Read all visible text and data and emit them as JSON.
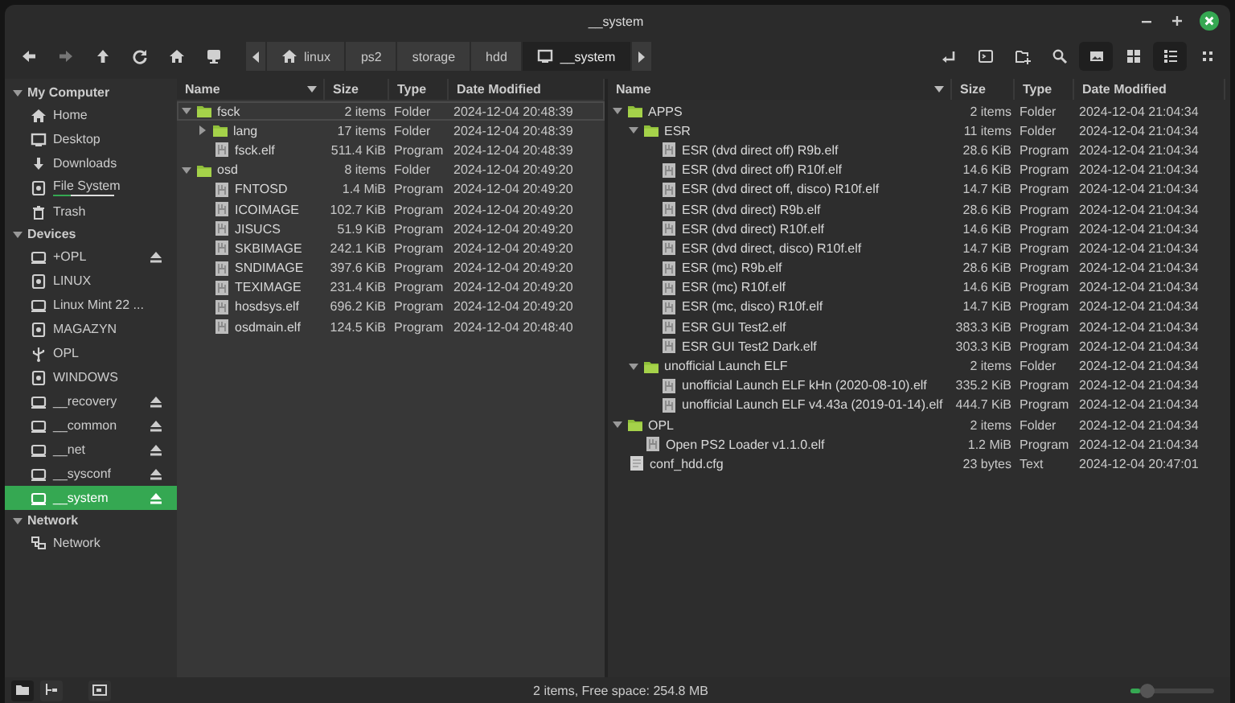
{
  "window": {
    "title": "__system"
  },
  "toolbar": {
    "nav": [
      {
        "kind": "back",
        "disabled": false
      },
      {
        "kind": "forward",
        "disabled": true
      },
      {
        "kind": "up",
        "disabled": false
      },
      {
        "kind": "reload",
        "disabled": false
      },
      {
        "kind": "home",
        "disabled": false
      },
      {
        "kind": "computer",
        "disabled": false
      }
    ],
    "breadcrumb": [
      {
        "label": "linux",
        "kind": "home",
        "selected": false
      },
      {
        "label": "ps2",
        "kind": "plain",
        "selected": false
      },
      {
        "label": "storage",
        "kind": "plain",
        "selected": false
      },
      {
        "label": "hdd",
        "kind": "plain",
        "selected": false
      },
      {
        "label": "__system",
        "kind": "drive",
        "selected": true
      }
    ],
    "actions": [
      {
        "kind": "return"
      },
      {
        "kind": "terminal"
      },
      {
        "kind": "new-folder"
      },
      {
        "kind": "search"
      }
    ],
    "views": [
      {
        "kind": "thumbnails",
        "pressed": true
      },
      {
        "kind": "icons",
        "pressed": false
      },
      {
        "kind": "list",
        "pressed": true
      },
      {
        "kind": "compact",
        "pressed": false
      }
    ]
  },
  "sidebar": [
    {
      "title": "My Computer",
      "expanded": true,
      "items": [
        {
          "label": "Home",
          "kind": "home",
          "eject": false,
          "selected": false
        },
        {
          "label": "Desktop",
          "kind": "desktop",
          "eject": false,
          "selected": false
        },
        {
          "label": "Downloads",
          "kind": "download",
          "eject": false,
          "selected": false
        },
        {
          "label": "File System",
          "kind": "disk",
          "eject": false,
          "selected": false,
          "level": 0.3
        },
        {
          "label": "Trash",
          "kind": "trash",
          "eject": false,
          "selected": false
        }
      ]
    },
    {
      "title": "Devices",
      "expanded": true,
      "items": [
        {
          "label": "+OPL",
          "kind": "drive",
          "eject": true,
          "selected": false
        },
        {
          "label": "LINUX",
          "kind": "disk",
          "eject": false,
          "selected": false
        },
        {
          "label": "Linux Mint 22 ...",
          "kind": "drive",
          "eject": false,
          "selected": false
        },
        {
          "label": "MAGAZYN",
          "kind": "disk",
          "eject": false,
          "selected": false
        },
        {
          "label": "OPL",
          "kind": "usb",
          "eject": false,
          "selected": false
        },
        {
          "label": "WINDOWS",
          "kind": "disk",
          "eject": false,
          "selected": false
        },
        {
          "label": "__recovery",
          "kind": "drive",
          "eject": true,
          "selected": false
        },
        {
          "label": "__common",
          "kind": "drive",
          "eject": true,
          "selected": false
        },
        {
          "label": "__net",
          "kind": "drive",
          "eject": true,
          "selected": false
        },
        {
          "label": "__sysconf",
          "kind": "drive",
          "eject": true,
          "selected": false
        },
        {
          "label": "__system",
          "kind": "drive",
          "eject": true,
          "selected": true
        }
      ]
    },
    {
      "title": "Network",
      "expanded": true,
      "items": [
        {
          "label": "Network",
          "kind": "network",
          "eject": false,
          "selected": false
        }
      ]
    }
  ],
  "panes": [
    {
      "active": true,
      "columns": [
        {
          "label": "Name",
          "sorted": true
        },
        {
          "label": "Size",
          "sorted": false
        },
        {
          "label": "Type",
          "sorted": false
        },
        {
          "label": "Date Modified",
          "sorted": false
        }
      ],
      "rows": [
        {
          "name": "fsck",
          "kind": "folder",
          "expanded": true,
          "cursor": true,
          "size": "2 items",
          "type": "Folder",
          "date": "2024-12-04 20:48:39",
          "children": [
            {
              "name": "lang",
              "kind": "folder",
              "expanded": false,
              "cursor": false,
              "size": "17 items",
              "type": "Folder",
              "date": "2024-12-04 20:48:39"
            },
            {
              "name": "fsck.elf",
              "kind": "program",
              "cursor": false,
              "size": "511.4 KiB",
              "type": "Program",
              "date": "2024-12-04 20:48:39"
            }
          ]
        },
        {
          "name": "osd",
          "kind": "folder",
          "expanded": true,
          "cursor": false,
          "size": "8 items",
          "type": "Folder",
          "date": "2024-12-04 20:49:20",
          "children": [
            {
              "name": "FNTOSD",
              "kind": "program",
              "cursor": false,
              "size": "1.4 MiB",
              "type": "Program",
              "date": "2024-12-04 20:49:20"
            },
            {
              "name": "ICOIMAGE",
              "kind": "program",
              "cursor": false,
              "size": "102.7 KiB",
              "type": "Program",
              "date": "2024-12-04 20:49:20"
            },
            {
              "name": "JISUCS",
              "kind": "program",
              "cursor": false,
              "size": "51.9 KiB",
              "type": "Program",
              "date": "2024-12-04 20:49:20"
            },
            {
              "name": "SKBIMAGE",
              "kind": "program",
              "cursor": false,
              "size": "242.1 KiB",
              "type": "Program",
              "date": "2024-12-04 20:49:20"
            },
            {
              "name": "SNDIMAGE",
              "kind": "program",
              "cursor": false,
              "size": "397.6 KiB",
              "type": "Program",
              "date": "2024-12-04 20:49:20"
            },
            {
              "name": "TEXIMAGE",
              "kind": "program",
              "cursor": false,
              "size": "231.4 KiB",
              "type": "Program",
              "date": "2024-12-04 20:49:20"
            },
            {
              "name": "hosdsys.elf",
              "kind": "program",
              "cursor": false,
              "size": "696.2 KiB",
              "type": "Program",
              "date": "2024-12-04 20:49:20"
            },
            {
              "name": "osdmain.elf",
              "kind": "program",
              "cursor": false,
              "size": "124.5 KiB",
              "type": "Program",
              "date": "2024-12-04 20:48:40"
            }
          ]
        }
      ]
    },
    {
      "active": false,
      "columns": [
        {
          "label": "Name",
          "sorted": true
        },
        {
          "label": "Size",
          "sorted": false
        },
        {
          "label": "Type",
          "sorted": false
        },
        {
          "label": "Date Modified",
          "sorted": false
        }
      ],
      "rows": [
        {
          "name": "APPS",
          "kind": "folder",
          "expanded": true,
          "cursor": false,
          "size": "2 items",
          "type": "Folder",
          "date": "2024-12-04 21:04:34",
          "children": [
            {
              "name": "ESR",
              "kind": "folder",
              "expanded": true,
              "cursor": false,
              "size": "11 items",
              "type": "Folder",
              "date": "2024-12-04 21:04:34",
              "children": [
                {
                  "name": "ESR (dvd direct off) R9b.elf",
                  "kind": "program",
                  "cursor": false,
                  "size": "28.6 KiB",
                  "type": "Program",
                  "date": "2024-12-04 21:04:34"
                },
                {
                  "name": "ESR (dvd direct off) R10f.elf",
                  "kind": "program",
                  "cursor": false,
                  "size": "14.6 KiB",
                  "type": "Program",
                  "date": "2024-12-04 21:04:34"
                },
                {
                  "name": "ESR (dvd direct off, disco) R10f.elf",
                  "kind": "program",
                  "cursor": false,
                  "size": "14.7 KiB",
                  "type": "Program",
                  "date": "2024-12-04 21:04:34"
                },
                {
                  "name": "ESR (dvd direct) R9b.elf",
                  "kind": "program",
                  "cursor": false,
                  "size": "28.6 KiB",
                  "type": "Program",
                  "date": "2024-12-04 21:04:34"
                },
                {
                  "name": "ESR (dvd direct) R10f.elf",
                  "kind": "program",
                  "cursor": false,
                  "size": "14.6 KiB",
                  "type": "Program",
                  "date": "2024-12-04 21:04:34"
                },
                {
                  "name": "ESR (dvd direct, disco) R10f.elf",
                  "kind": "program",
                  "cursor": false,
                  "size": "14.7 KiB",
                  "type": "Program",
                  "date": "2024-12-04 21:04:34"
                },
                {
                  "name": "ESR (mc) R9b.elf",
                  "kind": "program",
                  "cursor": false,
                  "size": "28.6 KiB",
                  "type": "Program",
                  "date": "2024-12-04 21:04:34"
                },
                {
                  "name": "ESR (mc) R10f.elf",
                  "kind": "program",
                  "cursor": false,
                  "size": "14.6 KiB",
                  "type": "Program",
                  "date": "2024-12-04 21:04:34"
                },
                {
                  "name": "ESR (mc, disco) R10f.elf",
                  "kind": "program",
                  "cursor": false,
                  "size": "14.7 KiB",
                  "type": "Program",
                  "date": "2024-12-04 21:04:34"
                },
                {
                  "name": "ESR GUI Test2.elf",
                  "kind": "program",
                  "cursor": false,
                  "size": "383.3 KiB",
                  "type": "Program",
                  "date": "2024-12-04 21:04:34"
                },
                {
                  "name": "ESR GUI Test2 Dark.elf",
                  "kind": "program",
                  "cursor": false,
                  "size": "303.3 KiB",
                  "type": "Program",
                  "date": "2024-12-04 21:04:34"
                }
              ]
            },
            {
              "name": "unofficial Launch ELF",
              "kind": "folder",
              "expanded": true,
              "cursor": false,
              "size": "2 items",
              "type": "Folder",
              "date": "2024-12-04 21:04:34",
              "children": [
                {
                  "name": "unofficial Launch ELF kHn (2020-08-10).elf",
                  "kind": "program",
                  "cursor": false,
                  "size": "335.2 KiB",
                  "type": "Program",
                  "date": "2024-12-04 21:04:34"
                },
                {
                  "name": "unofficial Launch ELF v4.43a (2019-01-14).elf",
                  "kind": "program",
                  "cursor": false,
                  "size": "444.7 KiB",
                  "type": "Program",
                  "date": "2024-12-04 21:04:34"
                }
              ]
            }
          ]
        },
        {
          "name": "OPL",
          "kind": "folder",
          "expanded": true,
          "cursor": false,
          "size": "2 items",
          "type": "Folder",
          "date": "2024-12-04 21:04:34",
          "children": [
            {
              "name": "Open PS2 Loader v1.1.0.elf",
              "kind": "program",
              "cursor": false,
              "size": "1.2 MiB",
              "type": "Program",
              "date": "2024-12-04 21:04:34"
            }
          ]
        },
        {
          "name": "conf_hdd.cfg",
          "kind": "text",
          "cursor": false,
          "size": "23 bytes",
          "type": "Text",
          "date": "2024-12-04 20:47:01"
        }
      ]
    }
  ],
  "status_bar": {
    "buttons": [
      {
        "kind": "places",
        "pressed": true
      },
      {
        "kind": "tree",
        "pressed": false
      },
      {
        "kind": "split",
        "pressed": false
      }
    ],
    "text": "2 items, Free space: 254.8 MB",
    "zoom": {
      "level": 0.12
    }
  }
}
